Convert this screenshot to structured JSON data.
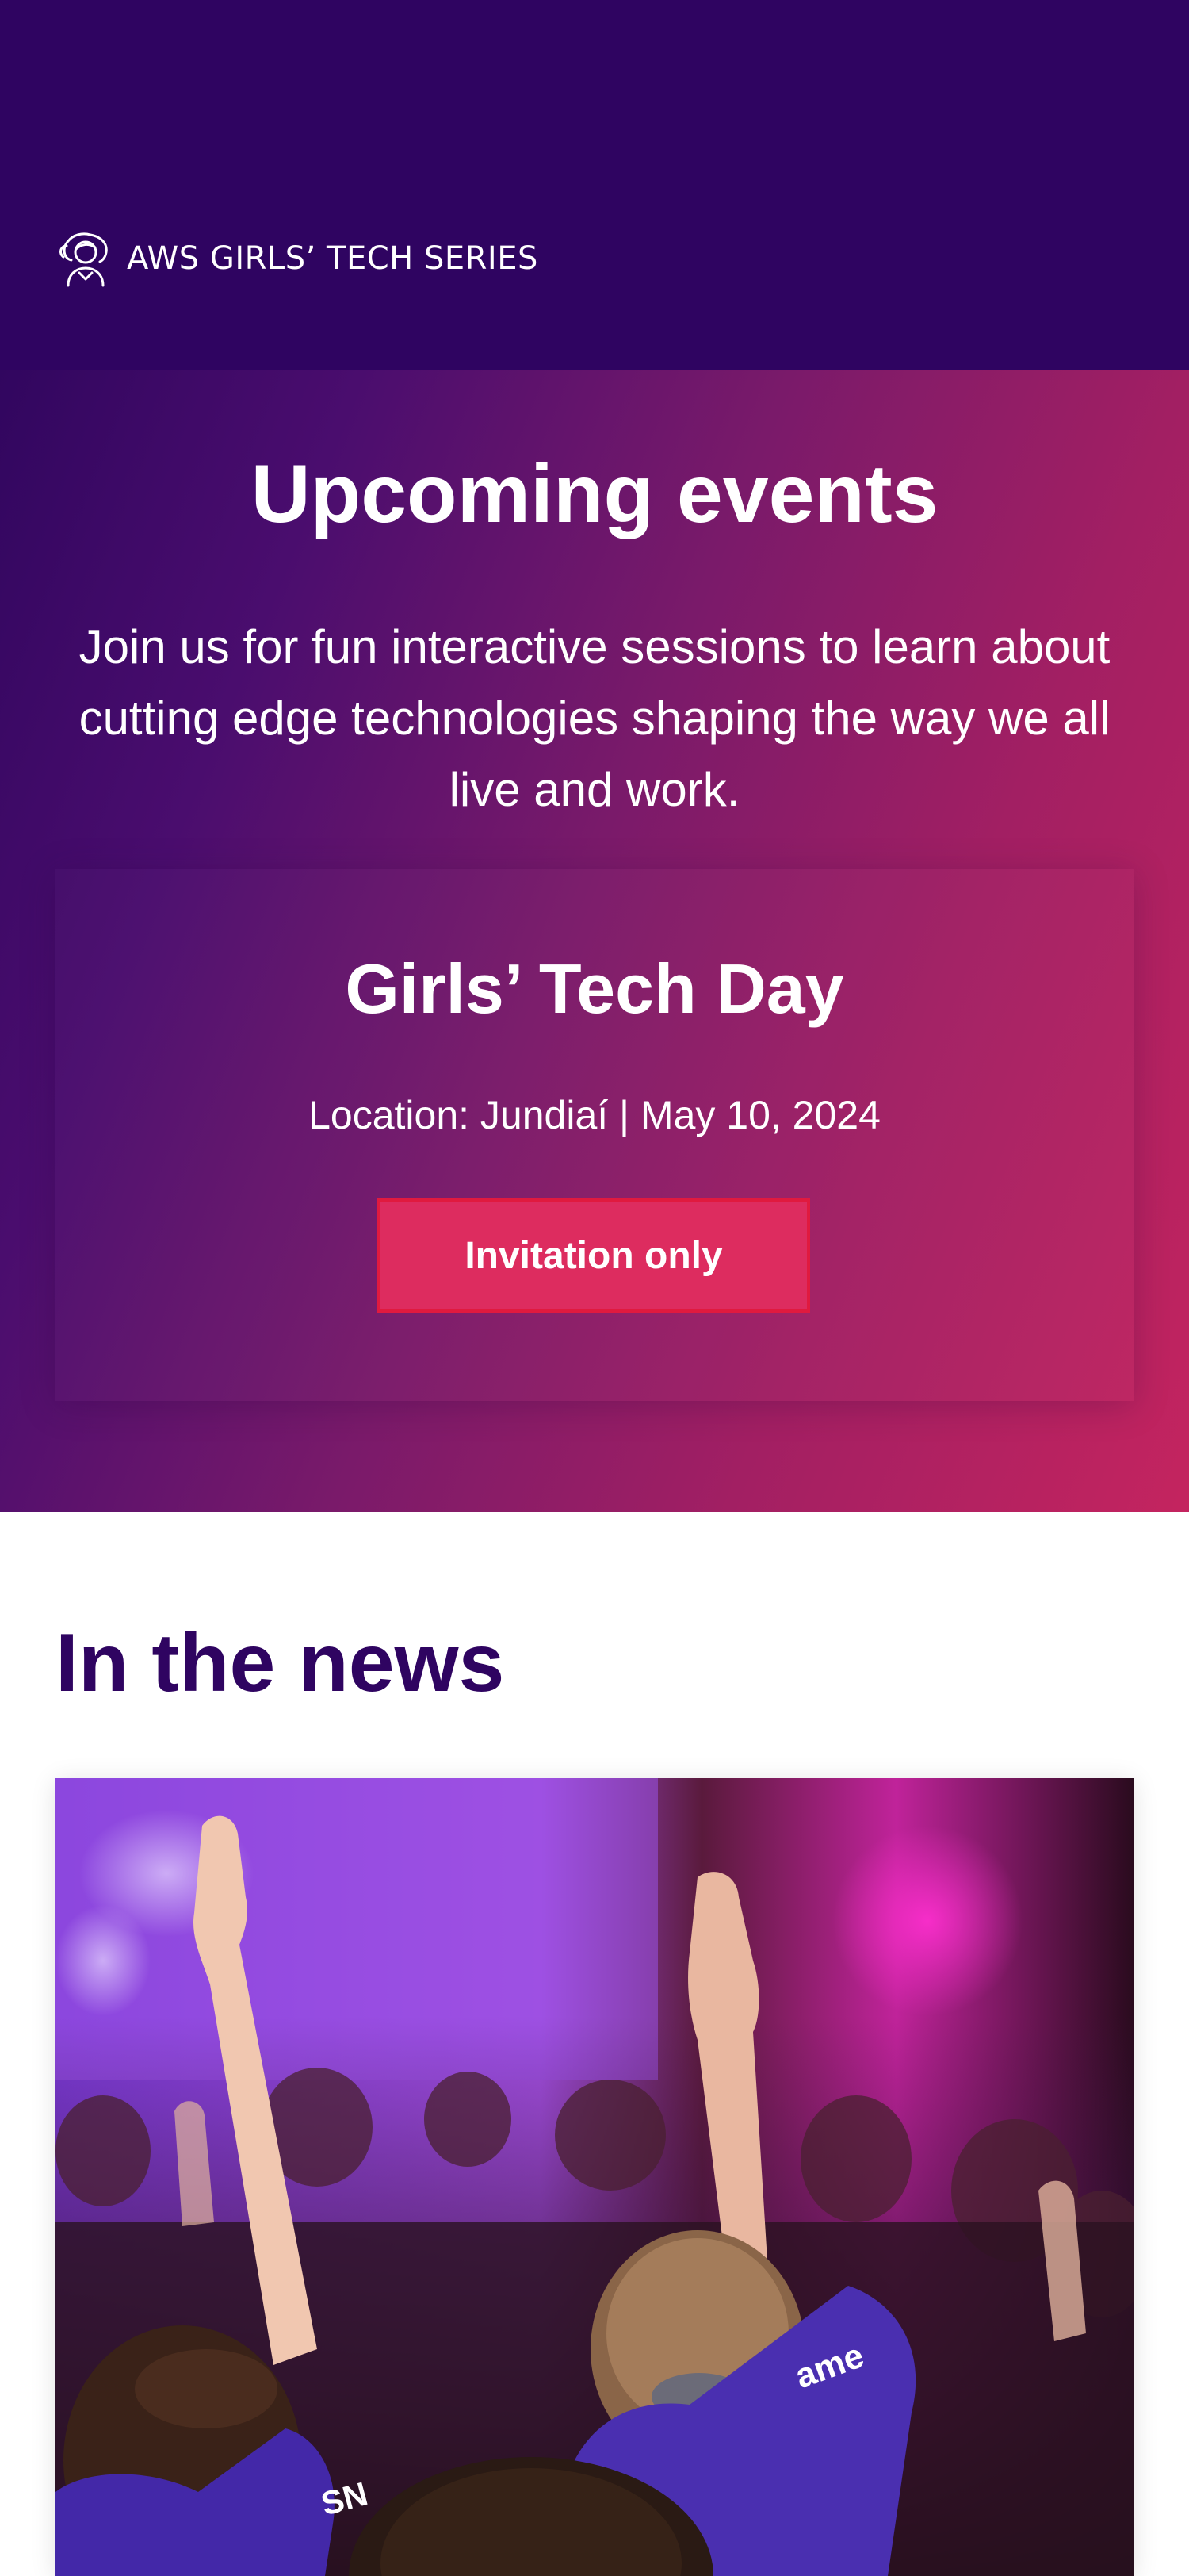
{
  "header": {
    "brand_text": "AWS GIRLS’ TECH SERIES",
    "logo_icon": "girl-avatar-icon",
    "background_color": "#2f0461"
  },
  "hero": {
    "title": "Upcoming events",
    "subtitle": "Join us for fun interactive sessions to learn about cutting edge technologies shaping the way we all live and work.",
    "gradient_colors": [
      "#31065f",
      "#7a1a6a",
      "#c4245f"
    ],
    "event": {
      "title": "Girls’ Tech Day",
      "meta": "Location: Jundiaí | May 10, 2024",
      "button_label": "Invitation only",
      "button_color": "#dd2c5f"
    }
  },
  "news": {
    "heading": "In the news",
    "heading_color": "#2f0461",
    "card_image": "audience-raising-hands-photo"
  }
}
